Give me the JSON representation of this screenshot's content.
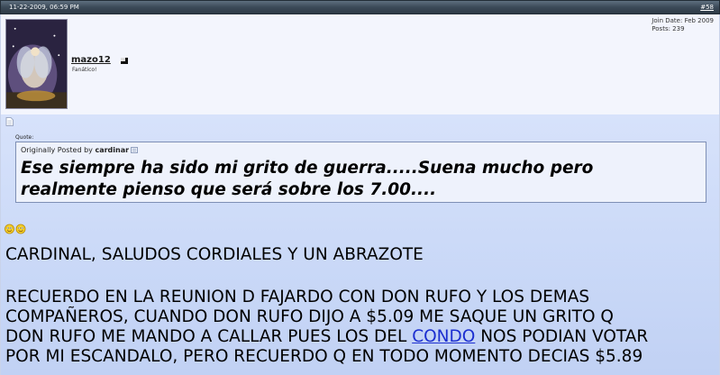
{
  "header": {
    "date": "11-22-2009, 06:59 PM",
    "post_number": "#58"
  },
  "user": {
    "username": "mazo12",
    "title": "Fanático!",
    "join_date": "Join Date: Feb 2009",
    "posts": "Posts: 239"
  },
  "quote": {
    "label": "Quote:",
    "origin_prefix": "Originally Posted by ",
    "origin_author": "cardinar",
    "text_line1": "Ese siempre ha sido mi grito de guerra.....Suena mucho pero",
    "text_line2": "realmente pienso que será sobre los 7.00...."
  },
  "message": {
    "greeting": "CARDINAL, SALUDOS CORDIALES Y UN ABRAZOTE",
    "line1": "RECUERDO EN LA REUNION D FAJARDO CON DON RUFO Y LOS DEMAS",
    "line2": "COMPAÑEROS, CUANDO DON RUFO DIJO A $5.09 ME SAQUE UN GRITO Q",
    "line3_before": "DON RUFO ME MANDO A CALLAR PUES LOS DEL ",
    "line3_link": "CONDO",
    "line3_after": " NOS PODIAN VOTAR",
    "line4": "POR MI ESCANDALO, PERO RECUERDO Q EN TODO MOMENTO DECIAS $5.89"
  },
  "icons": {
    "post_icon": "document-icon",
    "online_status": "online-status-icon",
    "view_post": "view-post-icon",
    "smilies": "smiley-icon"
  },
  "colors": {
    "header_bg": "#3c4a58",
    "message_bg": "#c9d8f7",
    "userinfo_bg": "#f3f5fd",
    "link": "#1c2fd0"
  }
}
